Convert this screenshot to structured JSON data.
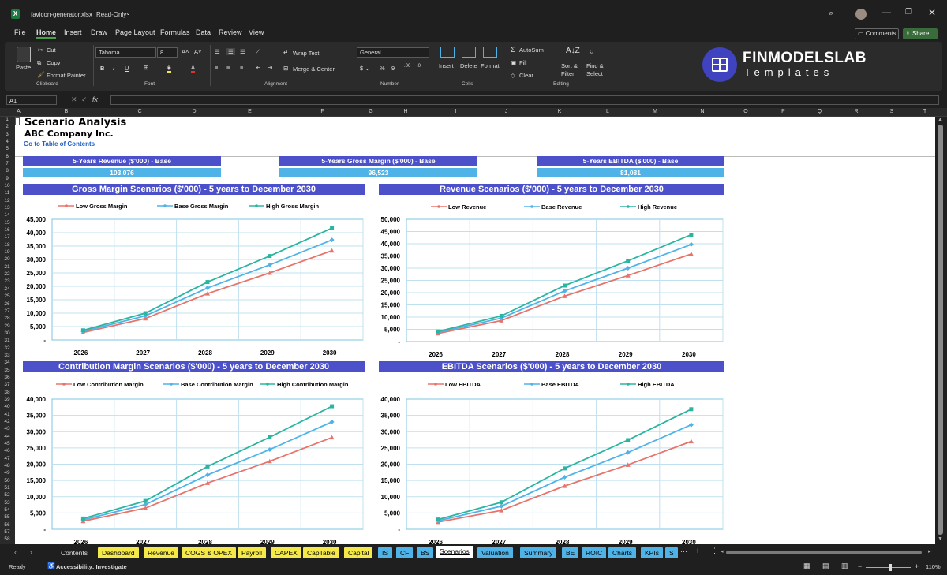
{
  "window": {
    "filename": "favicon-generator.xlsx",
    "mode": "Read-Only",
    "comments_label": "Comments",
    "share_label": "Share"
  },
  "menu_tabs": [
    "File",
    "Home",
    "Insert",
    "Draw",
    "Page Layout",
    "Formulas",
    "Data",
    "Review",
    "View"
  ],
  "ribbon": {
    "clipboard": {
      "paste": "Paste",
      "cut": "Cut",
      "copy": "Copy",
      "format_painter": "Format Painter",
      "group": "Clipboard"
    },
    "font": {
      "name": "Tahoma",
      "size": "8",
      "group": "Font"
    },
    "alignment": {
      "wrap": "Wrap Text",
      "merge": "Merge & Center",
      "group": "Alignment"
    },
    "number": {
      "format": "General",
      "group": "Number"
    },
    "cells": {
      "insert": "Insert",
      "delete": "Delete",
      "format": "Format",
      "group": "Cells"
    },
    "editing": {
      "autosum": "AutoSum",
      "fill": "Fill",
      "clear": "Clear",
      "sort": "Sort & Filter",
      "find": "Find & Select",
      "group": "Editing"
    },
    "logo": {
      "name": "FINMODELSLAB",
      "sub": "Templates"
    }
  },
  "formula_bar": {
    "name_box": "A1",
    "fx": "fx"
  },
  "columns": [
    "A",
    "B",
    "C",
    "D",
    "E",
    "F",
    "G",
    "H",
    "I",
    "J",
    "K",
    "L",
    "M",
    "N",
    "O",
    "P",
    "Q",
    "R",
    "S",
    "T"
  ],
  "sheet": {
    "title": "Scenario Analysis",
    "company": "ABC Company Inc.",
    "link": "Go to Table of Contents",
    "kpis": [
      {
        "label": "5-Years Revenue ($'000) - Base",
        "value": "103,076"
      },
      {
        "label": "5-Years Gross Margin ($'000) - Base",
        "value": "96,523"
      },
      {
        "label": "5-Years EBITDA ($'000) - Base",
        "value": "81,081"
      }
    ]
  },
  "chart_data": [
    {
      "type": "line",
      "title": "Gross Margin Scenarios ($'000) - 5 years to December 2030",
      "x": [
        "2026",
        "2027",
        "2028",
        "2029",
        "2030"
      ],
      "ylim": [
        0,
        45000
      ],
      "yticks": [
        "45,000",
        "40,000",
        "35,000",
        "30,000",
        "25,000",
        "20,000",
        "15,000",
        "10,000",
        "5,000",
        "-"
      ],
      "series": [
        {
          "name": "Low Gross Margin",
          "color": "#e8736a",
          "values": [
            2800,
            8000,
            17300,
            25000,
            33300
          ]
        },
        {
          "name": "Base Gross Margin",
          "color": "#4fb3e8",
          "values": [
            3200,
            9000,
            19400,
            28000,
            37300
          ]
        },
        {
          "name": "High Gross Margin",
          "color": "#2bb5a0",
          "values": [
            3600,
            10000,
            21600,
            31300,
            41700
          ]
        }
      ]
    },
    {
      "type": "line",
      "title": "Revenue Scenarios ($'000) - 5 years to December 2030",
      "x": [
        "2026",
        "2027",
        "2028",
        "2029",
        "2030"
      ],
      "ylim": [
        0,
        50000
      ],
      "yticks": [
        "50,000",
        "45,000",
        "40,000",
        "35,000",
        "30,000",
        "25,000",
        "20,000",
        "15,000",
        "10,000",
        "5,000",
        "-"
      ],
      "series": [
        {
          "name": "Low Revenue",
          "color": "#e8736a",
          "values": [
            3300,
            8600,
            18600,
            27000,
            35800
          ]
        },
        {
          "name": "Base Revenue",
          "color": "#4fb3e8",
          "values": [
            3700,
            9600,
            20700,
            30000,
            39700
          ]
        },
        {
          "name": "High Revenue",
          "color": "#2bb5a0",
          "values": [
            4100,
            10500,
            22900,
            33000,
            43700
          ]
        }
      ]
    },
    {
      "type": "line",
      "title": "Contribution Margin Scenarios ($'000) - 5 years to December 2030",
      "x": [
        "2026",
        "2027",
        "2028",
        "2029",
        "2030"
      ],
      "ylim": [
        0,
        40000
      ],
      "yticks": [
        "40,000",
        "35,000",
        "30,000",
        "25,000",
        "20,000",
        "15,000",
        "10,000",
        "5,000",
        "-"
      ],
      "series": [
        {
          "name": "Low Contribution Margin",
          "color": "#e8736a",
          "values": [
            2500,
            6500,
            14200,
            20900,
            28200
          ]
        },
        {
          "name": "Base Contribution Margin",
          "color": "#4fb3e8",
          "values": [
            2900,
            7600,
            16700,
            24500,
            33000
          ]
        },
        {
          "name": "High Contribution Margin",
          "color": "#2bb5a0",
          "values": [
            3300,
            8700,
            19300,
            28300,
            37800
          ]
        }
      ]
    },
    {
      "type": "line",
      "title": "EBITDA Scenarios ($'000) - 5 years to December 2030",
      "x": [
        "2026",
        "2027",
        "2028",
        "2029",
        "2030"
      ],
      "ylim": [
        0,
        40000
      ],
      "yticks": [
        "40,000",
        "35,000",
        "30,000",
        "25,000",
        "20,000",
        "15,000",
        "10,000",
        "5,000",
        "-"
      ],
      "series": [
        {
          "name": "Low EBITDA",
          "color": "#e8736a",
          "values": [
            2200,
            5800,
            13300,
            19800,
            27000
          ]
        },
        {
          "name": "Base EBITDA",
          "color": "#4fb3e8",
          "values": [
            2600,
            7100,
            16000,
            23600,
            32100
          ]
        },
        {
          "name": "High EBITDA",
          "color": "#2bb5a0",
          "values": [
            3000,
            8300,
            18700,
            27400,
            36900
          ]
        }
      ]
    }
  ],
  "sheet_tabs": [
    {
      "label": "Contents",
      "color": "none"
    },
    {
      "label": "Dashboard",
      "color": "#f5e94a"
    },
    {
      "label": "Revenue",
      "color": "#f5e94a"
    },
    {
      "label": "COGS & OPEX",
      "color": "#f5e94a"
    },
    {
      "label": "Payroll",
      "color": "#f5e94a"
    },
    {
      "label": "CAPEX",
      "color": "#f5e94a"
    },
    {
      "label": "CapTable",
      "color": "#f5e94a"
    },
    {
      "label": "Capital",
      "color": "#f5e94a"
    },
    {
      "label": "IS",
      "color": "#4fb3e8"
    },
    {
      "label": "CF",
      "color": "#4fb3e8"
    },
    {
      "label": "BS",
      "color": "#4fb3e8"
    },
    {
      "label": "Scenarios",
      "color": "active"
    },
    {
      "label": "Valuation",
      "color": "#4fb3e8"
    },
    {
      "label": "Summary",
      "color": "#4fb3e8"
    },
    {
      "label": "BE",
      "color": "#4fb3e8"
    },
    {
      "label": "ROIC",
      "color": "#4fb3e8"
    },
    {
      "label": "Charts",
      "color": "#4fb3e8"
    },
    {
      "label": "KPIs",
      "color": "#4fb3e8"
    },
    {
      "label": "S",
      "color": "#4fb3e8"
    }
  ],
  "status": {
    "ready": "Ready",
    "accessibility": "Accessibility: Investigate",
    "zoom": "110%"
  }
}
